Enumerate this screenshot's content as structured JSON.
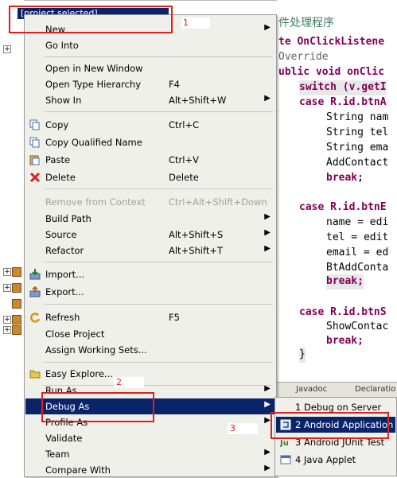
{
  "editor": {
    "lines": [
      "件处理程序",
      "te OnClickListene",
      "Override",
      "ublic void onClic",
      "switch (v.getI",
      "case R.id.btnA",
      "String nam",
      "String tel",
      "String ema",
      "AddContact",
      "break;",
      "",
      "case R.id.btnE",
      "name = edi",
      "tel = edit",
      "email = ed",
      "BtAddConta",
      "break;",
      "",
      "case R.id.btnS",
      "ShowContac",
      "break;",
      "}"
    ]
  },
  "tree": {
    "selected": "[project selected]"
  },
  "tabs": [
    "Javadoc",
    "Declaratio"
  ],
  "menu": {
    "items": [
      {
        "label": "New",
        "shortcut": ""
      },
      {
        "label": "Go Into",
        "shortcut": ""
      },
      {
        "label": "Open in New Window",
        "shortcut": ""
      },
      {
        "label": "Open Type Hierarchy",
        "shortcut": "F4"
      },
      {
        "label": "Show In",
        "shortcut": "Alt+Shift+W"
      },
      {
        "label": "Copy",
        "shortcut": "Ctrl+C"
      },
      {
        "label": "Copy Qualified Name",
        "shortcut": ""
      },
      {
        "label": "Paste",
        "shortcut": "Ctrl+V"
      },
      {
        "label": "Delete",
        "shortcut": "Delete"
      },
      {
        "label": "Remove from Context",
        "shortcut": "Ctrl+Alt+Shift+Down"
      },
      {
        "label": "Build Path",
        "shortcut": ""
      },
      {
        "label": "Source",
        "shortcut": "Alt+Shift+S"
      },
      {
        "label": "Refactor",
        "shortcut": "Alt+Shift+T"
      },
      {
        "label": "Import...",
        "shortcut": ""
      },
      {
        "label": "Export...",
        "shortcut": ""
      },
      {
        "label": "Refresh",
        "shortcut": "F5"
      },
      {
        "label": "Close Project",
        "shortcut": ""
      },
      {
        "label": "Assign Working Sets...",
        "shortcut": ""
      },
      {
        "label": "Easy Explore...",
        "shortcut": ""
      },
      {
        "label": "Run As",
        "shortcut": ""
      },
      {
        "label": "Debug As",
        "shortcut": ""
      },
      {
        "label": "Profile As",
        "shortcut": ""
      },
      {
        "label": "Validate",
        "shortcut": ""
      },
      {
        "label": "Team",
        "shortcut": ""
      },
      {
        "label": "Compare With",
        "shortcut": ""
      }
    ]
  },
  "submenu": {
    "items": [
      {
        "label": "1 Debug on Server"
      },
      {
        "label": "2 Android Application"
      },
      {
        "label": "3 Android JUnit Test"
      },
      {
        "label": "4 Java Applet"
      }
    ]
  },
  "annotations": [
    "1",
    "2",
    "3"
  ],
  "colors": {
    "selection": "#0a246a",
    "annotation": "#e0201c",
    "menu_bg": "#f0f0ea"
  }
}
